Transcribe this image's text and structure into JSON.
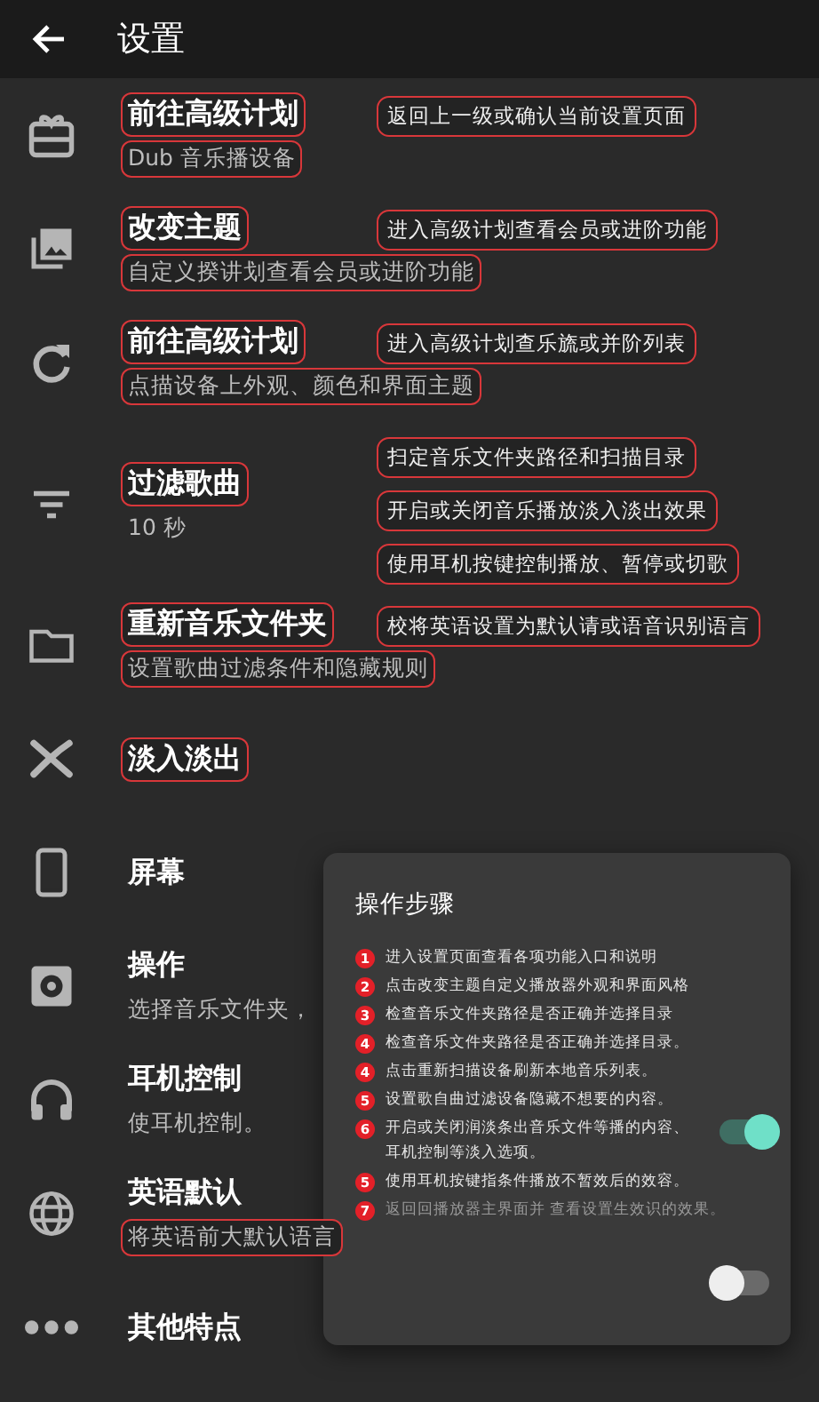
{
  "header": {
    "title": "设置"
  },
  "items": [
    {
      "kind": "gift",
      "title": "前往高级计划",
      "title_marked": true,
      "subtitle": "Dub 音乐播设备",
      "subtitle_marked": true,
      "notes": [
        "返回上一级或确认当前设置页面"
      ]
    },
    {
      "kind": "photos",
      "title": "改变主题",
      "title_marked": true,
      "subtitle": "自定义揆讲划查看会员或进阶功能",
      "subtitle_marked": true,
      "notes": [
        "进入高级计划查看会员或进阶功能"
      ]
    },
    {
      "kind": "refresh",
      "title": "前往高级计划",
      "title_marked": true,
      "subtitle": "点描设备上外观、颜色和界面主题",
      "subtitle_marked": true,
      "notes": [
        "进入高级计划查乐旒或并阶列表"
      ]
    },
    {
      "kind": "filter",
      "title": "过滤歌曲",
      "title_marked": true,
      "subtitle": "10 秒",
      "subtitle_marked": false,
      "notes": [
        "扫定音乐文件夹路径和扫描目录",
        "开启或关闭音乐播放淡入淡出效果",
        "使用耳机按键控制播放、暂停或切歌"
      ]
    },
    {
      "kind": "folder",
      "title": "重新音乐文件夹",
      "title_marked": true,
      "subtitle": "设置歌曲过滤条件和隐藏规则",
      "subtitle_marked": true,
      "notes": [
        "校将英语设置为默认请或语音识别语言"
      ]
    },
    {
      "kind": "shuffle",
      "title": "淡入淡出",
      "title_marked": true
    },
    {
      "kind": "phone",
      "title": "屏幕",
      "title_marked": false
    },
    {
      "kind": "gear",
      "title": "操作",
      "title_marked": false,
      "subtitle": "选择音乐文件夹，",
      "subtitle_marked": false
    },
    {
      "kind": "headphones",
      "title": "耳机控制",
      "title_marked": false,
      "subtitle": "使耳机控制。",
      "subtitle_marked": false
    },
    {
      "kind": "globe",
      "title": "英语默认",
      "title_marked": false,
      "subtitle": "将英语前大默认语言",
      "subtitle_marked": true
    },
    {
      "kind": "dots",
      "title": "其他特点",
      "title_marked": false
    }
  ],
  "panel": {
    "title": "操作步骤",
    "steps": [
      {
        "number": "1",
        "lines": [
          "进入设置页面查看各项功能入口和说明"
        ],
        "dim": false
      },
      {
        "number": "2",
        "lines": [
          "点击改变主题自定义播放器外观和界面风格"
        ],
        "dim": false
      },
      {
        "number": "3",
        "lines": [
          "检查音乐文件夹路径是否正确并选择目录"
        ],
        "dim": false
      },
      {
        "number": "4",
        "lines": [
          "检查音乐文件夹路径是否正确并选择目录。"
        ],
        "dim": false
      },
      {
        "number": "4",
        "lines": [
          "点击重新扫描设备刷新本地音乐列表。"
        ],
        "dim": false
      },
      {
        "number": "5",
        "lines": [
          "设置歌自曲过滤设备隐藏不想要的内容。"
        ],
        "dim": false
      },
      {
        "number": "6",
        "lines": [
          "开启或关闭润淡条出音乐文件等播的内容、",
          "耳机控制等淡入选项。"
        ],
        "dim": false,
        "switch": {
          "on": true
        }
      },
      {
        "number": "5",
        "lines": [
          "使用耳机按键指条件播放不暂效后的效容。"
        ],
        "dim": false
      },
      {
        "number": "7",
        "lines": [
          "返回回播放器主界面并 查看设置生效识的效果。"
        ],
        "dim": true
      }
    ],
    "footer_switch": {
      "on": false
    }
  }
}
